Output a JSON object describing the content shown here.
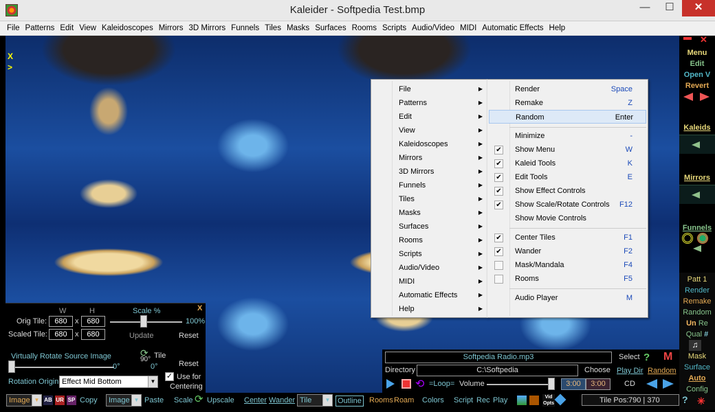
{
  "window": {
    "title": "Kaleider - Softpedia Test.bmp",
    "minimize": "—",
    "maximize": "☐",
    "close": "✕"
  },
  "menubar": [
    "File",
    "Patterns",
    "Edit",
    "View",
    "Kaleidoscopes",
    "Mirrors",
    "3D Mirrors",
    "Funnels",
    "Tiles",
    "Masks",
    "Surfaces",
    "Rooms",
    "Scripts",
    "Audio/Video",
    "MIDI",
    "Automatic Effects",
    "Help"
  ],
  "canvas": {
    "marker_x": "X",
    "marker_arrow": ">"
  },
  "context_menu": {
    "left": [
      "File",
      "Patterns",
      "Edit",
      "View",
      "Kaleidoscopes",
      "Mirrors",
      "3D Mirrors",
      "Funnels",
      "Tiles",
      "Masks",
      "Surfaces",
      "Rooms",
      "Scripts",
      "Audio/Video",
      "MIDI",
      "Automatic Effects",
      "Help"
    ],
    "right": [
      {
        "label": "Render",
        "key": "Space",
        "checked": null
      },
      {
        "label": "Remake",
        "key": "Z",
        "checked": null
      },
      {
        "label": "Random",
        "key": "Enter",
        "checked": null,
        "highlighted": true
      },
      {
        "label": "Minimize",
        "key": "-",
        "checked": null
      },
      {
        "label": "Show Menu",
        "key": "W",
        "checked": true
      },
      {
        "label": "Kaleid Tools",
        "key": "K",
        "checked": true
      },
      {
        "label": "Edit Tools",
        "key": "E",
        "checked": true
      },
      {
        "label": "Show Effect Controls",
        "key": "",
        "checked": true
      },
      {
        "label": "Show Scale/Rotate Controls",
        "key": "F12",
        "checked": true
      },
      {
        "label": "Show Movie Controls",
        "key": "",
        "checked": null
      },
      {
        "label": "Center Tiles",
        "key": "F1",
        "checked": true
      },
      {
        "label": "Wander",
        "key": "F2",
        "checked": true
      },
      {
        "label": "Mask/Mandala",
        "key": "F4",
        "checked": false
      },
      {
        "label": "Rooms",
        "key": "F5",
        "checked": false
      },
      {
        "label": "Audio Player",
        "key": "M",
        "checked": null
      }
    ]
  },
  "right_panel": {
    "menu": "Menu",
    "edit": "Edit",
    "open": "Open V",
    "revert": "Revert",
    "kaleids": "Kaleids",
    "mirrors": "Mirrors",
    "funnels": "Funnels",
    "patt": "Patt 1",
    "render": "Render",
    "remake": "Remake",
    "random": "Random",
    "un": "Un",
    "re": "Re",
    "qual": "Qual",
    "hash": "#",
    "mask": "Mask",
    "surface": "Surface",
    "auto": "Auto",
    "config": "Config",
    "help": "?"
  },
  "tile_panel": {
    "close": "X",
    "w_label": "W",
    "h_label": "H",
    "scale_label": "Scale %",
    "orig_label": "Orig Tile:",
    "scaled_label": "Scaled Tile:",
    "orig_w": "680",
    "orig_h": "680",
    "scaled_w": "680",
    "scaled_h": "680",
    "times": "x",
    "scale_value": "100%",
    "update": "Update",
    "reset": "Reset",
    "rotate_label": "Virtually Rotate Source Image",
    "rotate_value": "0°",
    "tile_rot": "90°",
    "tile": "Tile",
    "tile_value": "0°",
    "reset2": "Reset",
    "origin_label": "Rotation Origin",
    "origin_value": "Effect Mid Bottom",
    "use_label": "Use for",
    "centering": "Centering",
    "check": "✓"
  },
  "player": {
    "track": "Softpedia Radio.mp3",
    "select": "Select",
    "directory_label": "Directory",
    "directory": "C:\\Softpedia",
    "choose": "Choose",
    "play_dir": "Play Dir",
    "loop": "=Loop=",
    "volume": "Volume",
    "time1": "3:00",
    "time2": "3:00",
    "cd": "CD",
    "m": "M",
    "random": "Random",
    "question": "?"
  },
  "bottombar": {
    "image1": "Image",
    "copy": "Copy",
    "image2": "Image",
    "paste": "Paste",
    "scale": "Scale",
    "upscale": "Upscale",
    "center": "Center",
    "wander": "Wander",
    "tile": "Tile",
    "outline": "Outline",
    "rooms": "Rooms",
    "roam": "Roam",
    "colors": "Colors",
    "script": "Script",
    "rec": "Rec",
    "play": "Play",
    "vid": "Vid Opts",
    "tilepos_label": "Tile Pos:",
    "tilepos": "790 | 370"
  },
  "colors": {
    "accent_teal": "#7ec6d2",
    "accent_orange": "#e4aa54",
    "close_red": "#c7312a"
  }
}
